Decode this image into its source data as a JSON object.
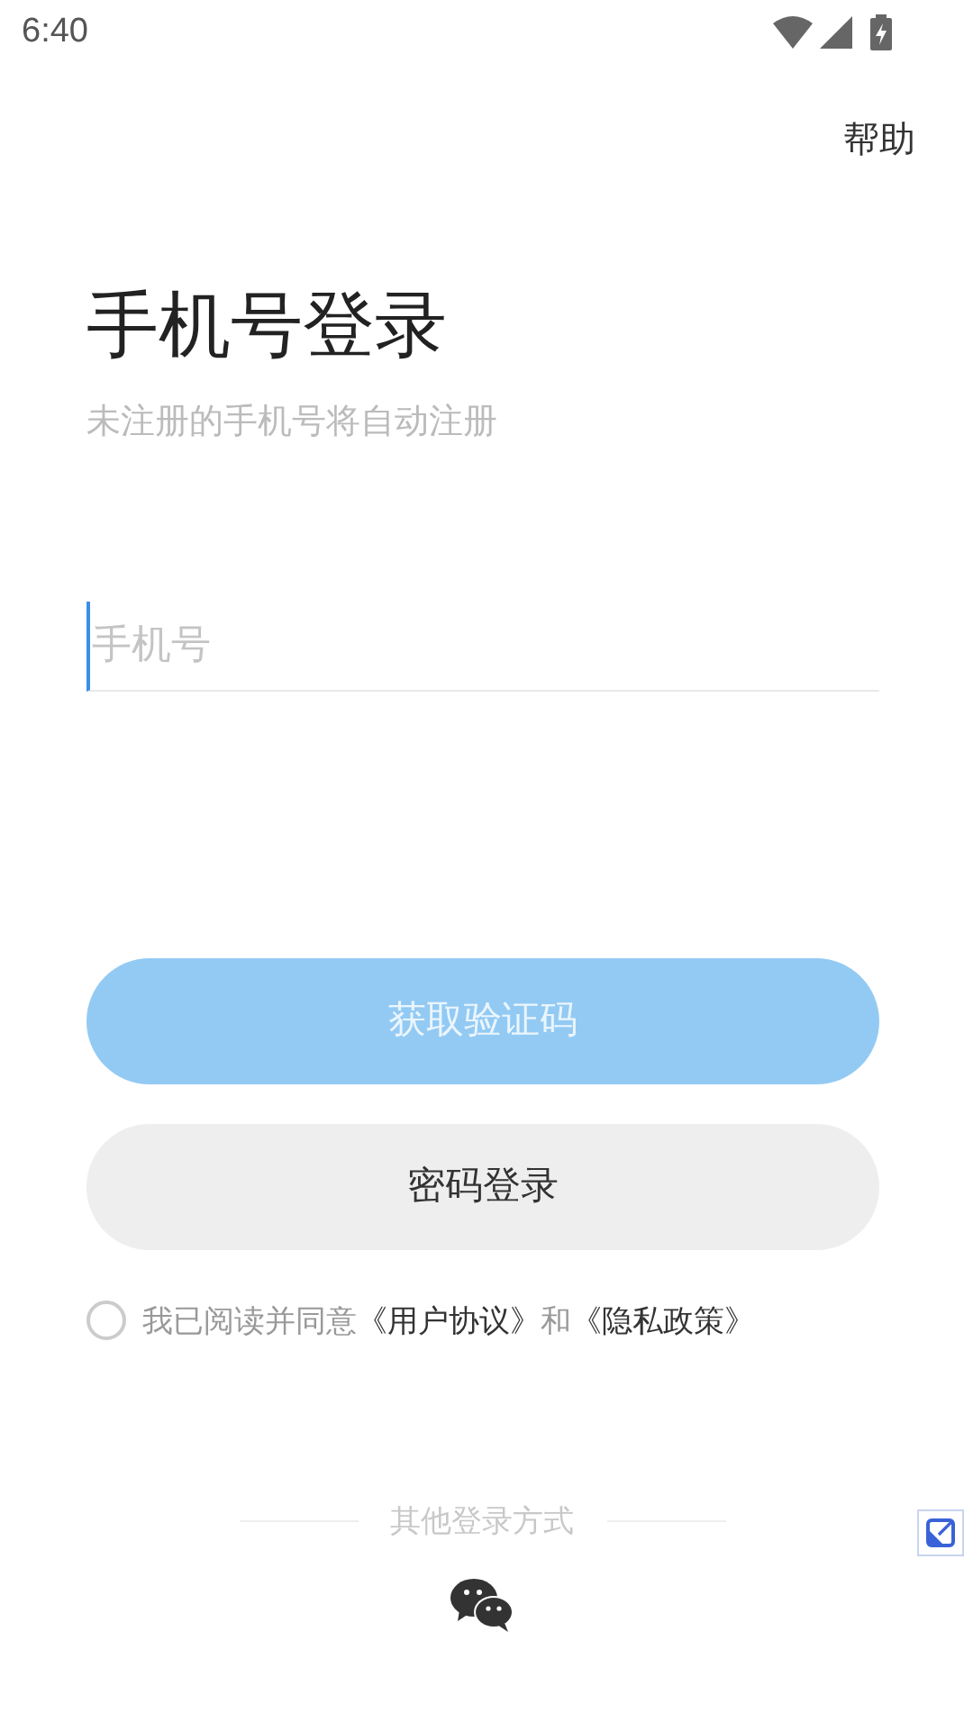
{
  "status_bar": {
    "time": "6:40"
  },
  "help": "帮助",
  "title": "手机号登录",
  "subtitle": "未注册的手机号将自动注册",
  "phone_field": {
    "placeholder": "手机号"
  },
  "buttons": [
    {
      "label": "获取验证码",
      "kind": "primary",
      "disabled": true
    },
    {
      "label": "密码登录",
      "kind": "secondary",
      "disabled": false
    }
  ],
  "agreement": {
    "checked": false,
    "parts": [
      {
        "kind": "text",
        "text": "我已阅读并同意"
      },
      {
        "kind": "link",
        "text": "《用户协议》"
      },
      {
        "kind": "text",
        "text": "和"
      },
      {
        "kind": "link",
        "text": "《隐私政策》"
      }
    ]
  },
  "other_login": {
    "label": "其他登录方式"
  }
}
